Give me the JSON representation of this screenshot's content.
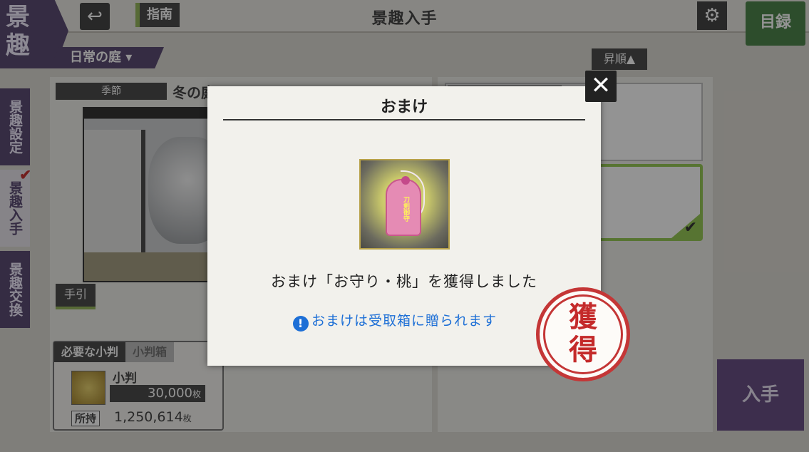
{
  "header": {
    "corner_tag": [
      "景",
      "趣"
    ],
    "back_icon": "undo-arrow-icon",
    "guide_label": "指南",
    "title": "景趣入手",
    "settings_icon": "gear-icon",
    "catalog_label": "目録"
  },
  "filters": {
    "garden_select": "日常の庭",
    "sort_label": "昇順▲"
  },
  "side_tabs": [
    {
      "label": "景趣設定",
      "active": false
    },
    {
      "label": "景趣入手",
      "active": true
    },
    {
      "label": "景趣交換",
      "active": false
    }
  ],
  "detail": {
    "season_label": "季節",
    "season_value": "冬の庭",
    "guide_book_label": "手引",
    "cost_tabs": [
      "必要な小判",
      "小判箱"
    ],
    "currency_name": "小判",
    "price": "30,000",
    "price_unit": "枚",
    "owned_label": "所持",
    "owned_value": "1,250,614",
    "owned_unit": "枚"
  },
  "acquire_button": "入手",
  "modal": {
    "title": "おまけ",
    "item_text": "刀剣御守",
    "message": "おまけ「お守り・桃」を獲得しました",
    "note": "おまけは受取箱に贈られます",
    "close_icon": "close-x-icon",
    "stamp_text": [
      "獲",
      "得"
    ]
  },
  "colors": {
    "accent_purple": "#4c3a66",
    "accent_green": "#3d7a3b",
    "stamp_red": "#c43636",
    "note_blue": "#1d6fd6"
  }
}
